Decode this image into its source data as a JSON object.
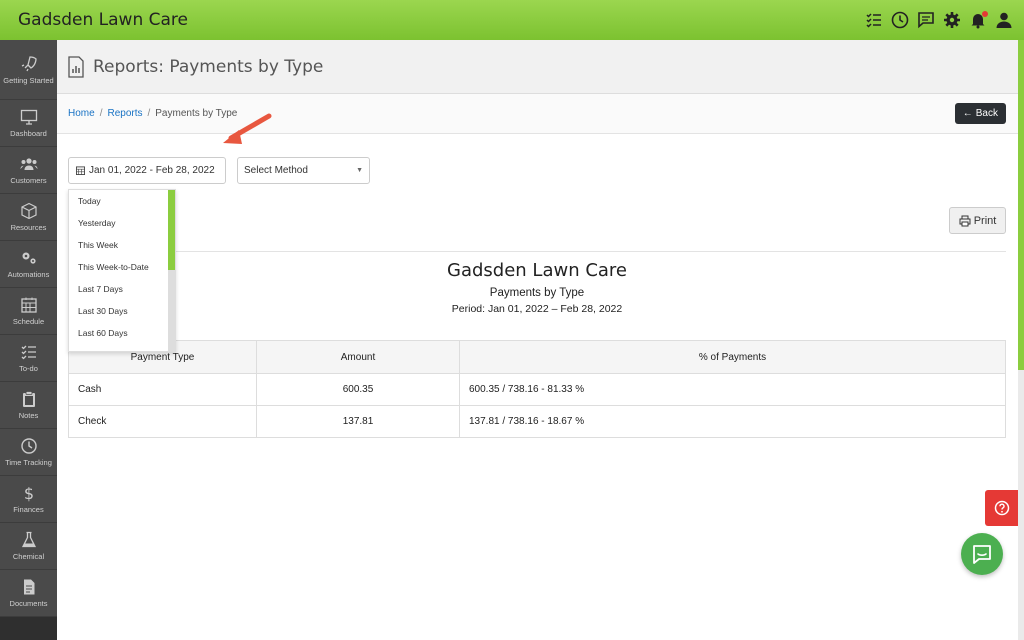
{
  "app": {
    "title": "Gadsden Lawn Care"
  },
  "top_icons": [
    "checklist-icon",
    "clock-icon",
    "chat-icon",
    "gear-icon",
    "bell-icon",
    "user-icon"
  ],
  "sidebar": {
    "items": [
      {
        "label": "Getting Started",
        "icon": "rocket-icon"
      },
      {
        "label": "Dashboard",
        "icon": "monitor-icon"
      },
      {
        "label": "Customers",
        "icon": "users-icon"
      },
      {
        "label": "Resources",
        "icon": "box-icon"
      },
      {
        "label": "Automations",
        "icon": "gears-icon"
      },
      {
        "label": "Schedule",
        "icon": "calendar-icon"
      },
      {
        "label": "To-do",
        "icon": "checklist-icon"
      },
      {
        "label": "Notes",
        "icon": "clipboard-icon"
      },
      {
        "label": "Time Tracking",
        "icon": "clock-icon"
      },
      {
        "label": "Finances",
        "icon": "dollar-icon"
      },
      {
        "label": "Chemical",
        "icon": "flask-icon"
      },
      {
        "label": "Documents",
        "icon": "document-icon"
      }
    ]
  },
  "page": {
    "title": "Reports: Payments by Type"
  },
  "breadcrumb": {
    "home": "Home",
    "reports": "Reports",
    "current": "Payments by Type"
  },
  "back_label": "Back",
  "filters": {
    "date_range": "Jan 01, 2022 - Feb 28, 2022",
    "method_placeholder": "Select Method"
  },
  "date_presets": [
    "Today",
    "Yesterday",
    "This Week",
    "This Week-to-Date",
    "Last 7 Days",
    "Last 30 Days",
    "Last 60 Days"
  ],
  "print_label": "Print",
  "report": {
    "company": "Gadsden Lawn Care",
    "subtitle": "Payments by Type",
    "period": "Period: Jan 01, 2022 – Feb 28, 2022",
    "columns": [
      "Payment Type",
      "Amount",
      "% of Payments"
    ],
    "rows": [
      {
        "type": "Cash",
        "amount": "600.35",
        "percent": "600.35 / 738.16 - 81.33 %"
      },
      {
        "type": "Check",
        "amount": "137.81",
        "percent": "137.81 / 738.16 - 18.67 %"
      }
    ]
  },
  "colors": {
    "accent": "#8bcd3f",
    "topbar": "#7cc230",
    "sidebar": "#2f2f2f",
    "help": "#e53935",
    "chat": "#4caf50"
  }
}
